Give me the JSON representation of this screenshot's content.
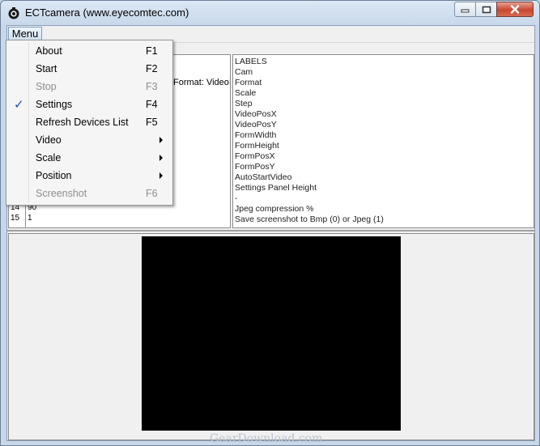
{
  "window": {
    "title": "ECTcamera (www.eyecomtec.com)"
  },
  "menubar": {
    "menu_label": "Menu"
  },
  "menu": {
    "items": [
      {
        "label": "About",
        "shortcut": "F1",
        "enabled": true,
        "checked": false,
        "submenu": false
      },
      {
        "label": "Start",
        "shortcut": "F2",
        "enabled": true,
        "checked": false,
        "submenu": false
      },
      {
        "label": "Stop",
        "shortcut": "F3",
        "enabled": false,
        "checked": false,
        "submenu": false
      },
      {
        "label": "Settings",
        "shortcut": "F4",
        "enabled": true,
        "checked": true,
        "submenu": false
      },
      {
        "label": "Refresh Devices List",
        "shortcut": "F5",
        "enabled": true,
        "checked": false,
        "submenu": false
      },
      {
        "label": "Video",
        "shortcut": "",
        "enabled": true,
        "checked": false,
        "submenu": true
      },
      {
        "label": "Scale",
        "shortcut": "",
        "enabled": true,
        "checked": false,
        "submenu": true
      },
      {
        "label": "Position",
        "shortcut": "",
        "enabled": true,
        "checked": false,
        "submenu": true
      },
      {
        "label": "Screenshot",
        "shortcut": "F6",
        "enabled": false,
        "checked": false,
        "submenu": false
      }
    ],
    "check_glyph": "✓"
  },
  "settings_grid": {
    "visible_text": "Format: VideoIr",
    "rows": [
      {
        "num": "14",
        "value": "90"
      },
      {
        "num": "15",
        "value": "1"
      }
    ]
  },
  "labels_panel": {
    "lines": [
      "LABELS",
      "Cam",
      "Format",
      "Scale",
      "Step",
      "VideoPosX",
      "VideoPosY",
      "FormWidth",
      "FormHeight",
      "FormPosX",
      "FormPosY",
      "AutoStartVideo",
      "Settings Panel Height",
      "-",
      "Jpeg compression %",
      "Save  screenshot to Bmp (0) or Jpeg (1)"
    ]
  },
  "watermark": "GearDownload.com",
  "colors": {
    "video_bg": "#000000",
    "close_button": "#c9462f",
    "check": "#1d50a8"
  }
}
